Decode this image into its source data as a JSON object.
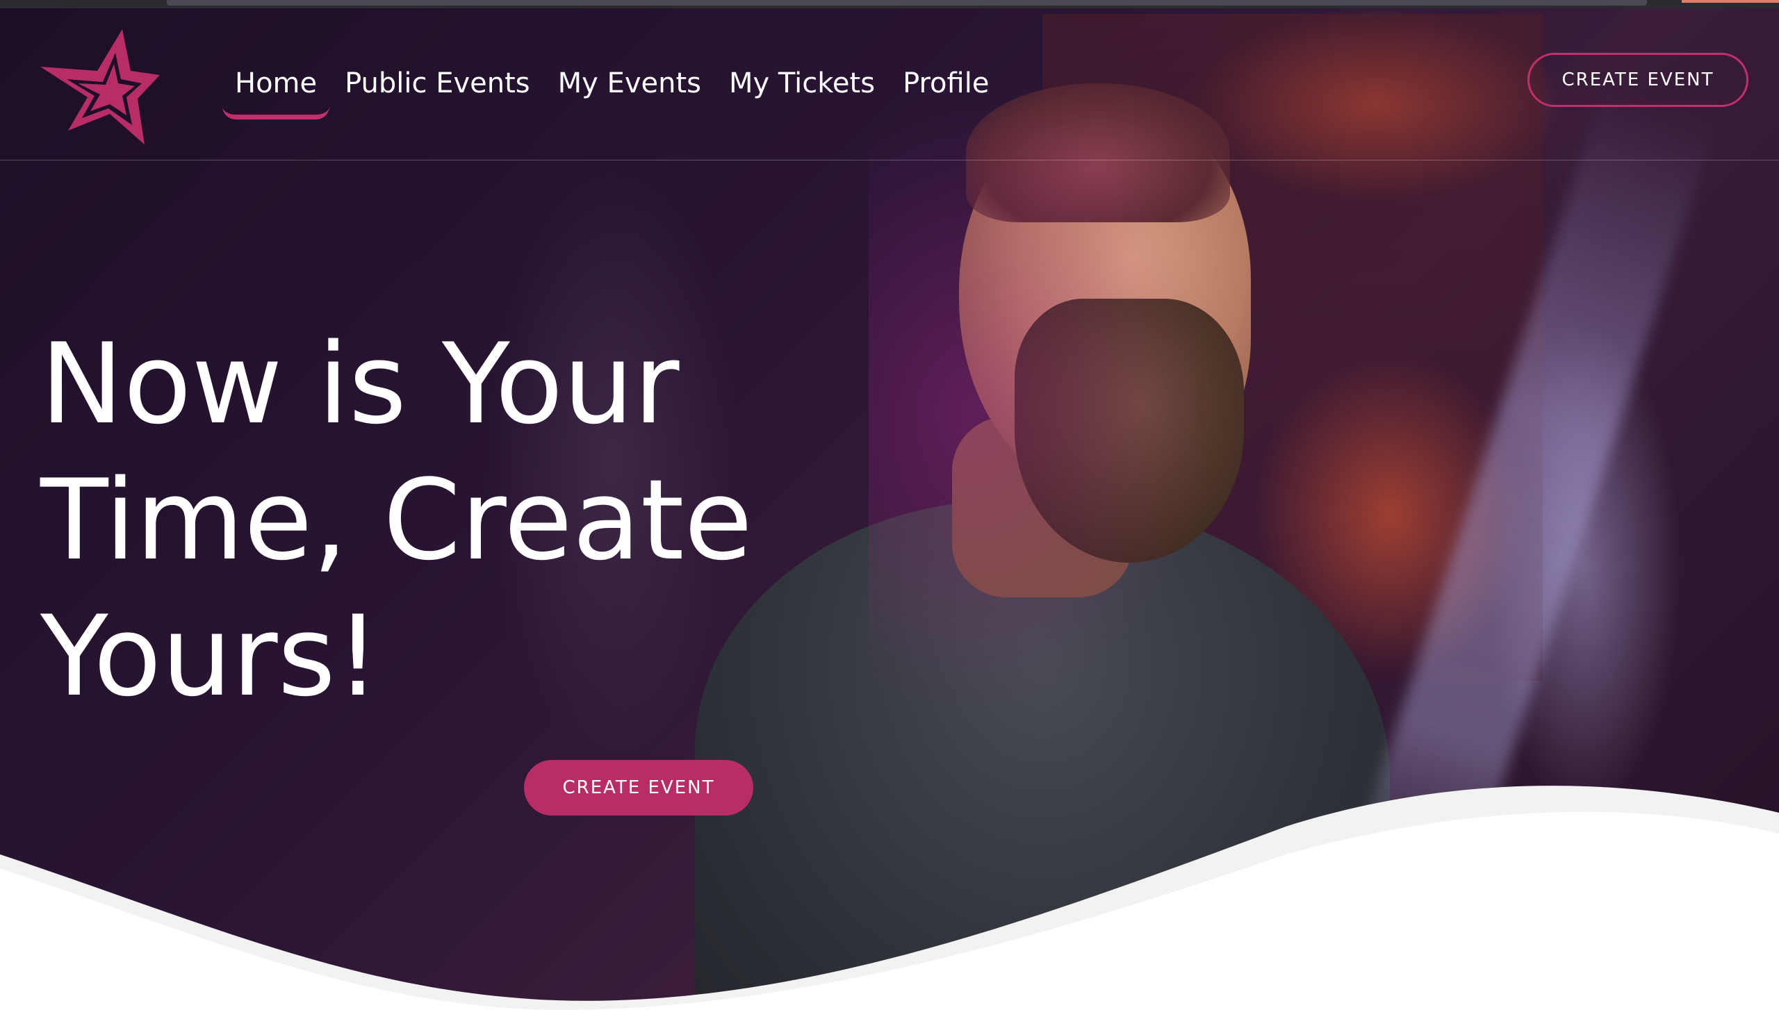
{
  "brand": {
    "logo_icon": "star-logo-icon",
    "accent_color": "#c2306b",
    "button_color": "#b92d66"
  },
  "nav": {
    "items": [
      {
        "label": "Home",
        "active": true
      },
      {
        "label": "Public Events",
        "active": false
      },
      {
        "label": "My Events",
        "active": false
      },
      {
        "label": "My Tickets",
        "active": false
      },
      {
        "label": "Profile",
        "active": false
      }
    ]
  },
  "header": {
    "cta_label": "CREATE EVENT"
  },
  "hero": {
    "headline_lines": [
      "Now is Your",
      "Time, Create",
      "Yours!"
    ],
    "cta_label": "CREATE EVENT"
  }
}
